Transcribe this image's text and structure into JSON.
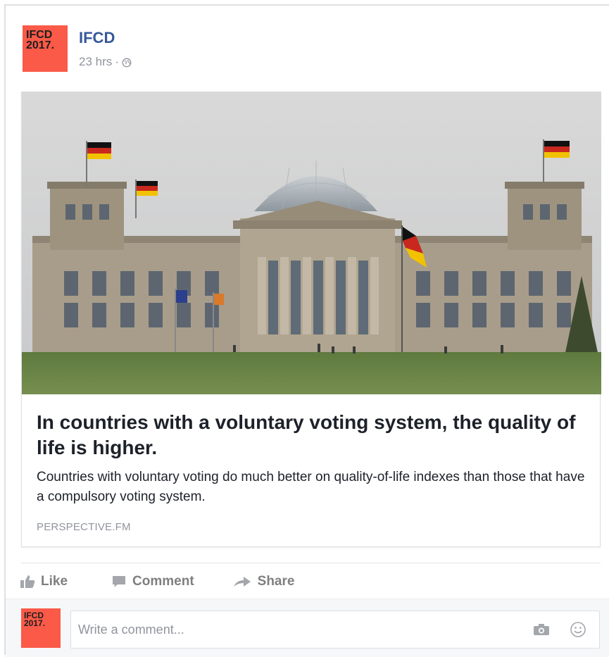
{
  "post": {
    "page_name": "IFCD",
    "avatar_text_line1": "IFCD",
    "avatar_text_line2": "2017.",
    "time": "23 hrs",
    "separator": "·",
    "privacy_icon": "globe-icon"
  },
  "link_preview": {
    "image_description_icon": "photo",
    "title": "In countries with a voluntary voting system, the quality of life is higher.",
    "description": "Countries with voluntary voting do much better on quality-of-life indexes than those that have a compulsory voting system.",
    "domain": "PERSPECTIVE.FM"
  },
  "actions": {
    "like": "Like",
    "comment": "Comment",
    "share": "Share"
  },
  "comment_box": {
    "placeholder": "Write a comment...",
    "camera_icon": "camera-icon",
    "emoji_icon": "emoji-icon"
  },
  "colors": {
    "brand": "#365899",
    "avatar_bg": "#fa5a47",
    "muted": "#90949c"
  }
}
